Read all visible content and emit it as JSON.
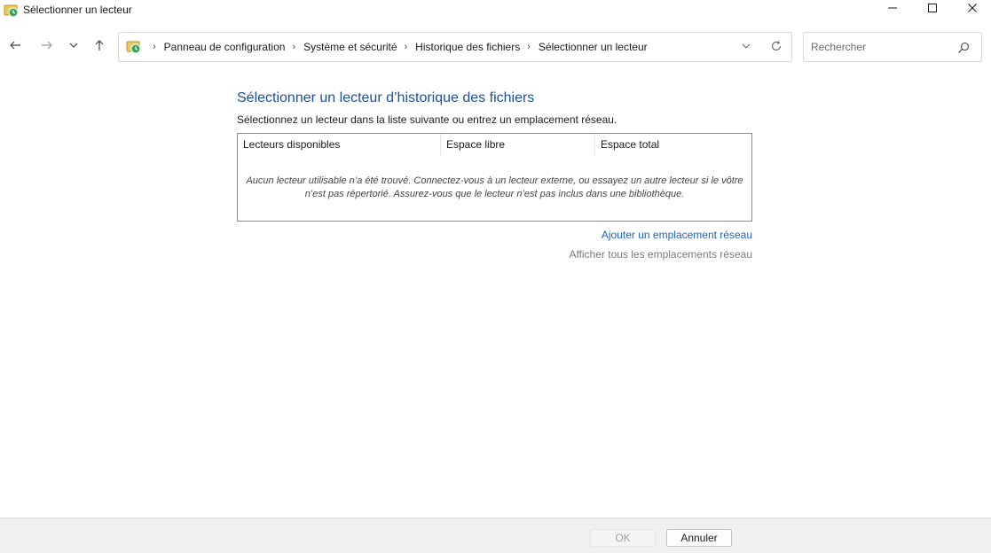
{
  "window": {
    "title": "Sélectionner un lecteur",
    "controls": {
      "minimize_icon": "minimize-icon",
      "maximize_icon": "maximize-icon",
      "close_icon": "close-icon"
    }
  },
  "navigation": {
    "breadcrumb": [
      "Panneau de configuration",
      "Système et sécurité",
      "Historique des fichiers",
      "Sélectionner un lecteur"
    ],
    "search_placeholder": "Rechercher",
    "search_value": ""
  },
  "main": {
    "heading": "Sélectionner un lecteur d’historique des fichiers",
    "instructions": "Sélectionnez un lecteur dans la liste suivante ou entrez un emplacement réseau.",
    "drive_list": {
      "columns": [
        "Lecteurs disponibles",
        "Espace libre",
        "Espace total"
      ],
      "rows": [],
      "empty_message": "Aucun lecteur utilisable n’a été trouvé. Connectez-vous à un lecteur externe, ou essayez un autre lecteur si le vôtre n’est pas répertorié. Assurez-vous que le lecteur n’est pas inclus dans une bibliothèque."
    },
    "links": {
      "add_network": "Ajouter un emplacement réseau",
      "show_all_network": "Afficher tous les emplacements réseau"
    }
  },
  "footer": {
    "ok_label": "OK",
    "ok_enabled": false,
    "cancel_label": "Annuler"
  },
  "colors": {
    "heading": "#1e4e9e",
    "link": "#1e63b8",
    "link_muted": "#7a7a7a",
    "footer_bg": "#f0f0f0"
  }
}
